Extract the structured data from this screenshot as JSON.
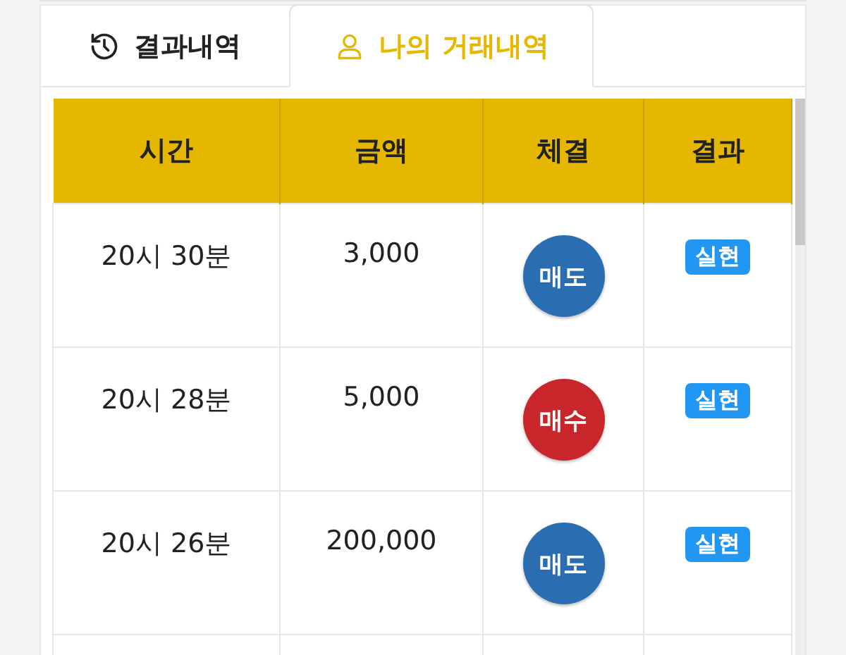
{
  "tabs": [
    {
      "label": "결과내역",
      "selected": false
    },
    {
      "label": "나의 거래내역",
      "selected": true
    }
  ],
  "table": {
    "columns": [
      "시간",
      "금액",
      "체결",
      "결과"
    ],
    "rows": [
      {
        "time": "20시 30분",
        "amount": "3,000",
        "trade": {
          "label": "매도",
          "kind": "sell"
        },
        "result": "실현"
      },
      {
        "time": "20시 28분",
        "amount": "5,000",
        "trade": {
          "label": "매수",
          "kind": "buy"
        },
        "result": "실현"
      },
      {
        "time": "20시 26분",
        "amount": "200,000",
        "trade": {
          "label": "매도",
          "kind": "sell"
        },
        "result": "실현"
      }
    ]
  }
}
